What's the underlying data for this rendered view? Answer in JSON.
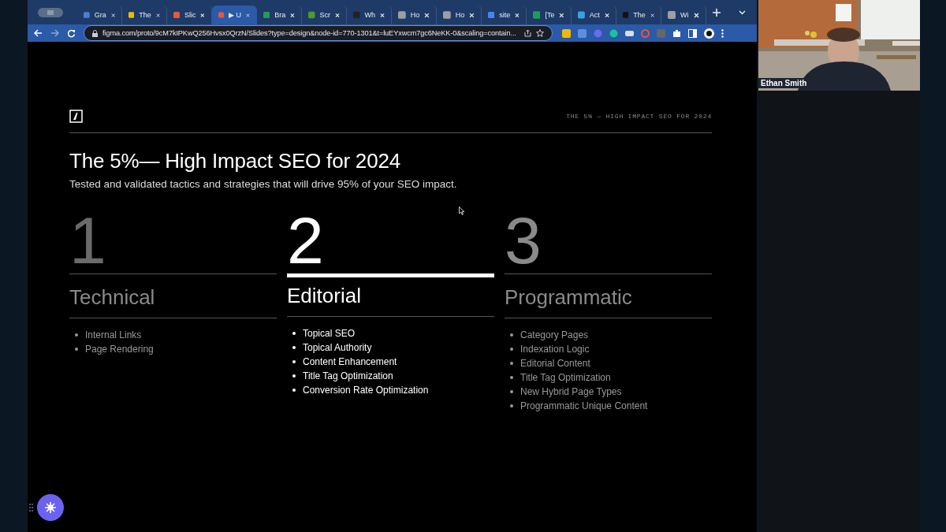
{
  "browser": {
    "tabs": [
      {
        "title": "Gra",
        "selected": false,
        "color": "#4a7fd8"
      },
      {
        "title": "The",
        "selected": false,
        "color": "#f2b900"
      },
      {
        "title": "Slic",
        "selected": false,
        "color": "#e8583a"
      },
      {
        "title": "▶ U",
        "selected": true,
        "color": "#e8583a"
      },
      {
        "title": "Bra",
        "selected": false,
        "color": "#1e9e55"
      },
      {
        "title": "Scr",
        "selected": false,
        "color": "#4b9b2f"
      },
      {
        "title": "Wh",
        "selected": false,
        "color": "#222222"
      },
      {
        "title": "Ho",
        "selected": false,
        "color": "#9aa0a6"
      },
      {
        "title": "Ho",
        "selected": false,
        "color": "#9aa0a6"
      },
      {
        "title": "site",
        "selected": false,
        "color": "#4285f4"
      },
      {
        "title": "[Te",
        "selected": false,
        "color": "#1e9e55"
      },
      {
        "title": "Act",
        "selected": false,
        "color": "#3aa0e0"
      },
      {
        "title": "The",
        "selected": false,
        "color": "#111111"
      },
      {
        "title": "Wi",
        "selected": false,
        "color": "#9aa0a6"
      }
    ],
    "url": "figma.com/proto/9cM7kIPKwQ256Hvsx0QrzN/Slides?type=design&node-id=770-1301&t=luEYxwcm7gc6NeKK-0&scaling=contain..."
  },
  "slide": {
    "header": "THE 5% — HIGH IMPACT SEO FOR 2024",
    "title": "The 5%— High Impact SEO for 2024",
    "subtitle": "Tested and validated tactics and strategies that will drive 95% of your SEO impact.",
    "columns": [
      {
        "number": "1",
        "title": "Technical",
        "selected": false,
        "items": [
          "Internal Links",
          "Page Rendering"
        ]
      },
      {
        "number": "2",
        "title": "Editorial",
        "selected": true,
        "items": [
          "Topical SEO",
          "Topical Authority",
          "Content Enhancement",
          "Title Tag Optimization",
          "Conversion Rate Optimization"
        ]
      },
      {
        "number": "3",
        "title": "Programmatic",
        "selected": false,
        "items": [
          "Category Pages",
          "Indexation Logic",
          "Editorial Content",
          "Title Tag Optimization",
          "New Hybrid Page Types",
          "Programmatic Unique Content"
        ]
      }
    ]
  },
  "participant": {
    "name": "Ethan Smith",
    "kind": "picture"
  }
}
